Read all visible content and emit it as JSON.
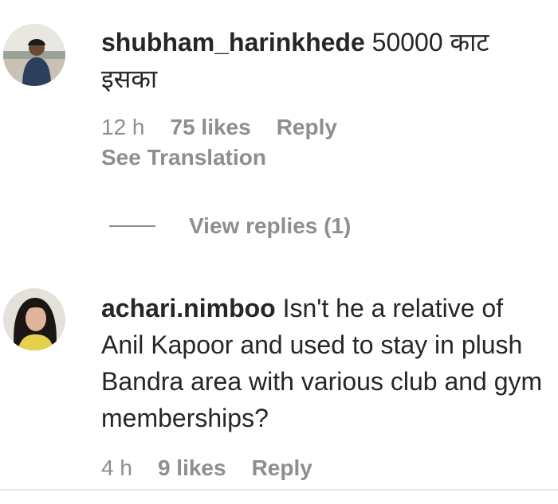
{
  "comments": [
    {
      "avatar_icon": "user-avatar-photo",
      "username": "shubham_harinkhede",
      "text": "50000 काट इसका",
      "time": "12 h",
      "likes": "75 likes",
      "reply": "Reply",
      "see_translation": "See Translation"
    },
    {
      "avatar_icon": "user-avatar-photo",
      "username": "achari.nimboo",
      "text": "Isn't he a relative of Anil Kapoor and used to stay in plush Bandra area with various club and gym memberships?",
      "time": "4 h",
      "likes": "9 likes",
      "reply": "Reply"
    }
  ],
  "view_replies": "View replies (1)",
  "colors": {
    "text": "#262626",
    "secondary": "#8e8e8e",
    "divider": "#e6e6e6"
  }
}
